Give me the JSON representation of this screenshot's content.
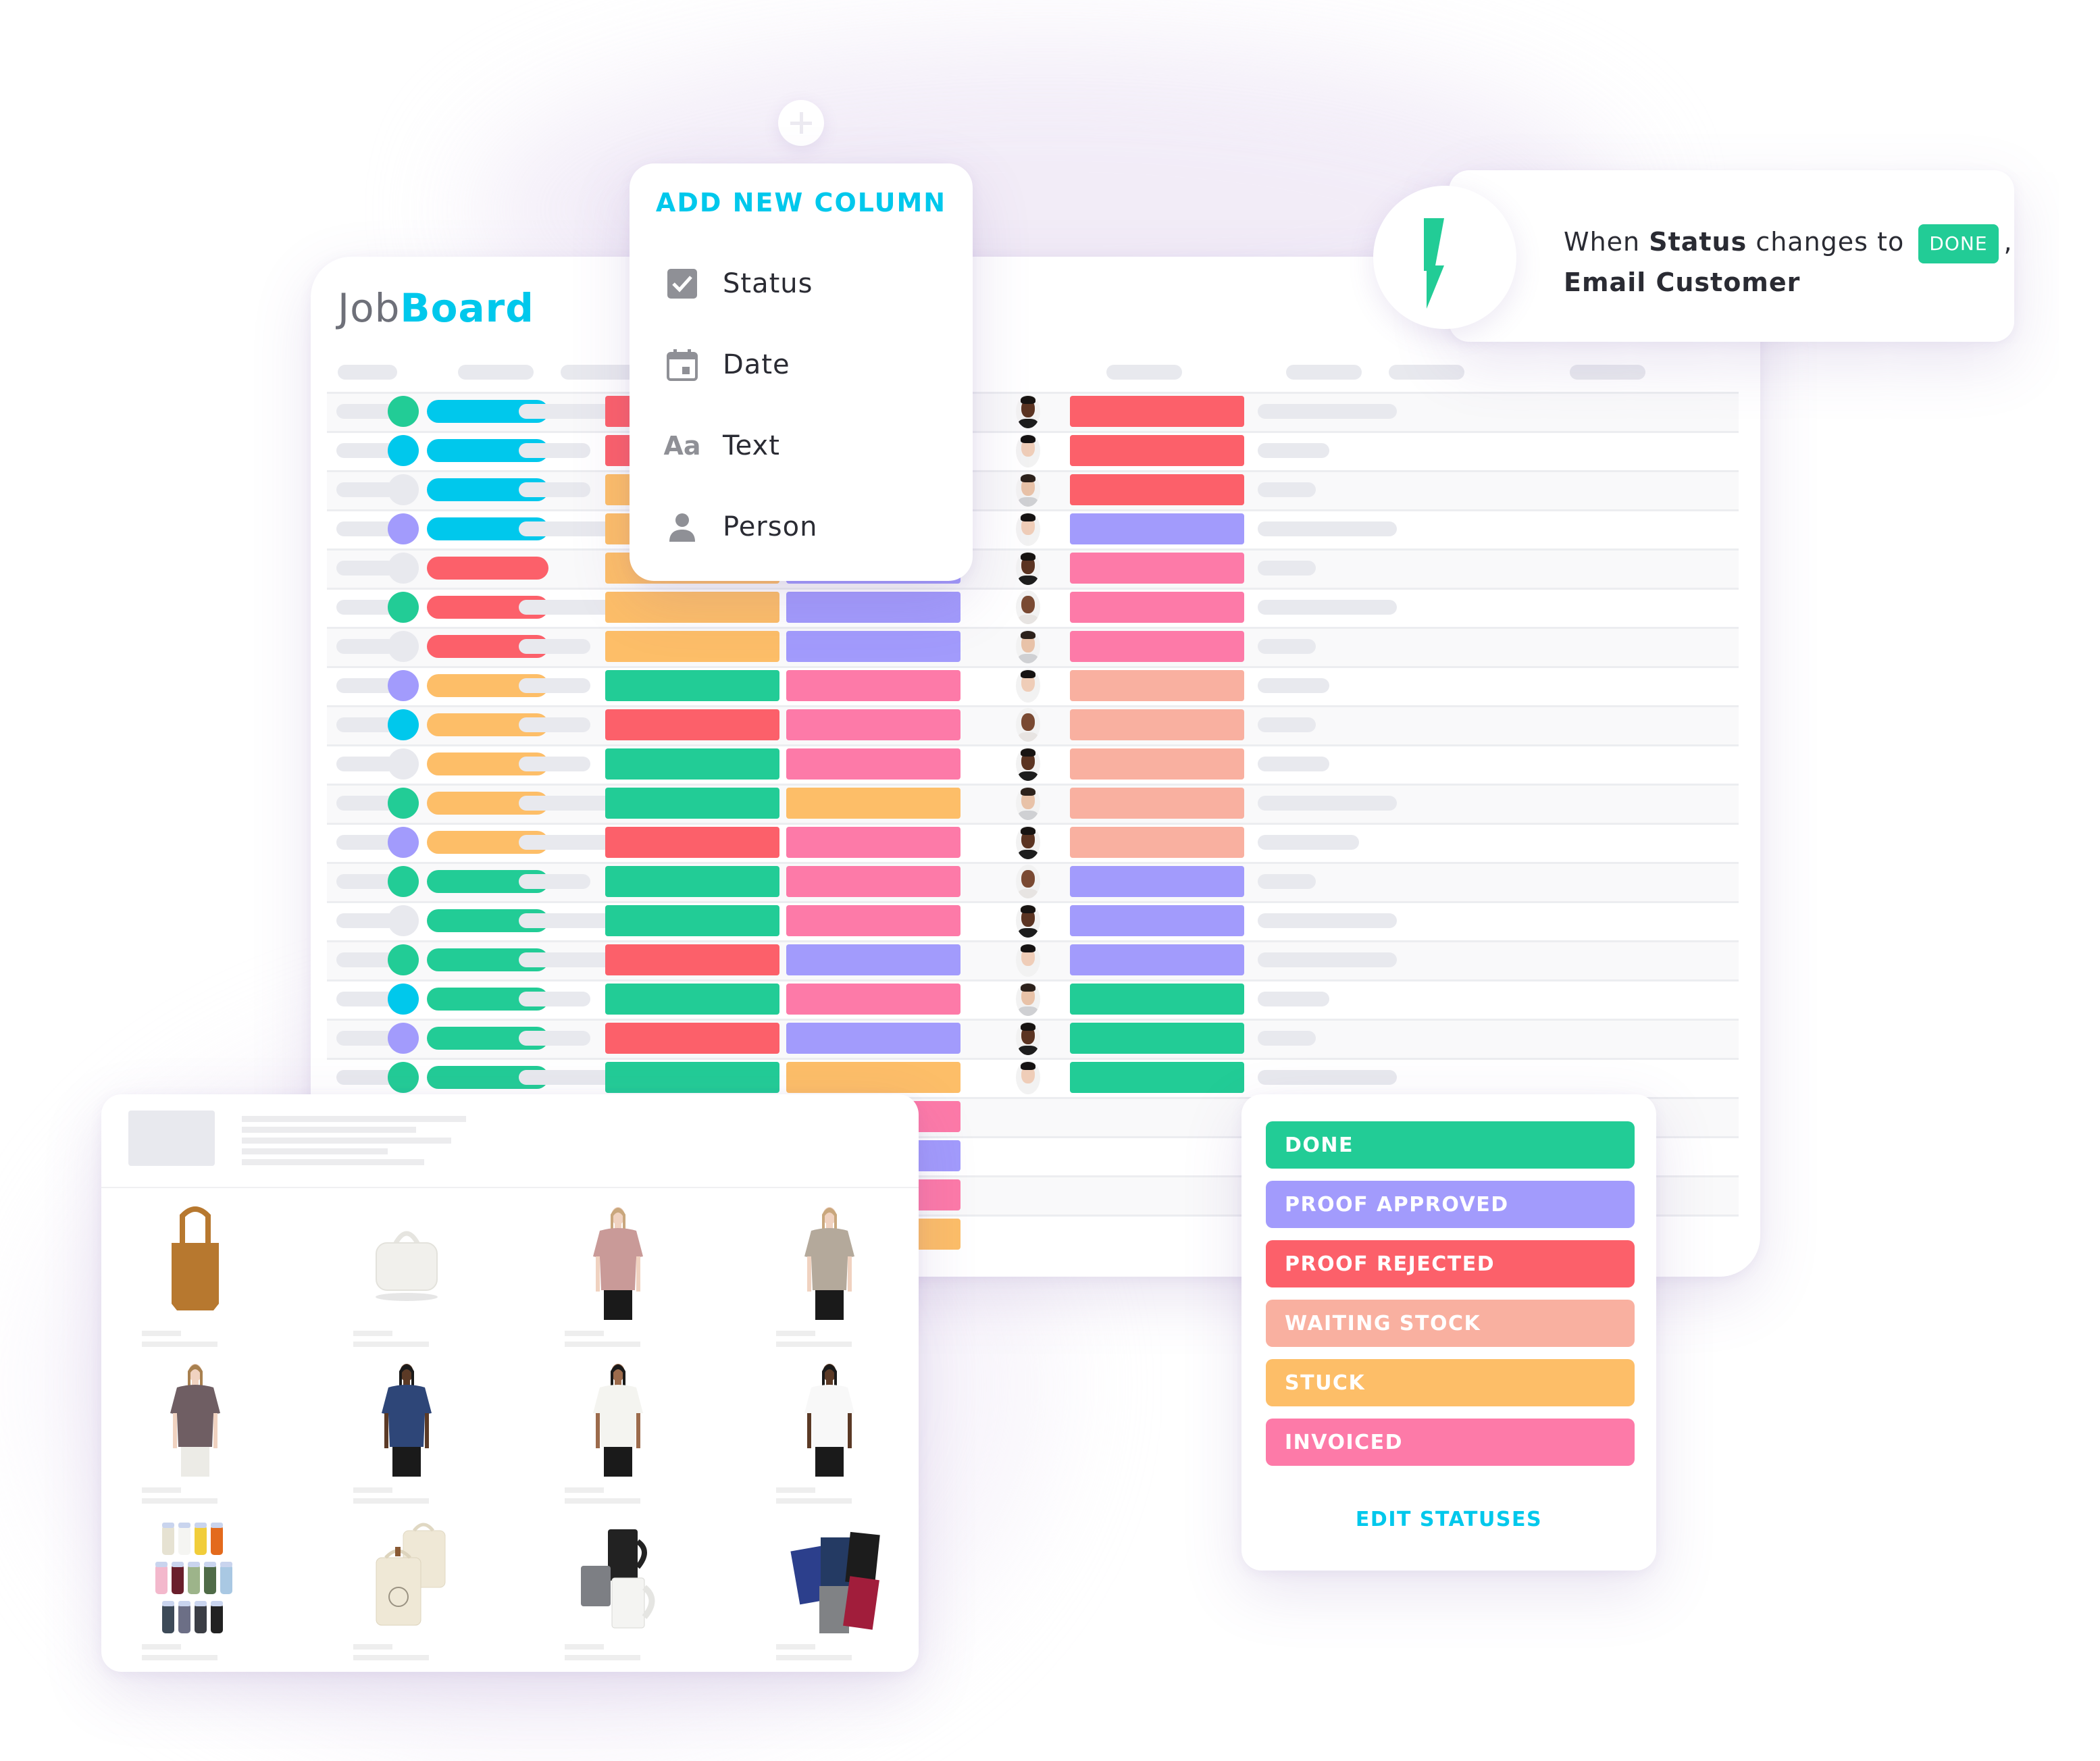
{
  "app": {
    "logo_part1": "Job",
    "logo_part2": "Board"
  },
  "colors": {
    "accent": "#00c8ec",
    "done": "#22cc96",
    "proof_approved": "#a29bfc",
    "proof_rejected": "#fc606a",
    "waiting_stock": "#f9b0a0",
    "stuck": "#fdbe68",
    "invoiced": "#fd7aa8",
    "cyan": "#00c8ec",
    "grey": "#e8e9ee"
  },
  "add_column": {
    "plus_icon": "plus-icon",
    "title": "ADD NEW COLUMN",
    "items": [
      {
        "icon": "checkbox-icon",
        "label": "Status"
      },
      {
        "icon": "calendar-icon",
        "label": "Date"
      },
      {
        "icon": "text-icon",
        "icon_text": "Aa",
        "label": "Text"
      },
      {
        "icon": "person-icon",
        "label": "Person"
      }
    ]
  },
  "automation": {
    "icon": "lightning-icon",
    "prefix": "When",
    "field": "Status",
    "middle": "changes to",
    "badge": "DONE",
    "comma": ",",
    "action": "Email Customer"
  },
  "status_menu": {
    "options": [
      {
        "label": "DONE",
        "color": "#22cc96"
      },
      {
        "label": "PROOF APPROVED",
        "color": "#a29bfc"
      },
      {
        "label": "PROOF REJECTED",
        "color": "#fc606a"
      },
      {
        "label": "WAITING STOCK",
        "color": "#f9b0a0"
      },
      {
        "label": "STUCK",
        "color": "#fdbe68"
      },
      {
        "label": "INVOICED",
        "color": "#fd7aa8"
      }
    ],
    "edit_label": "EDIT STATUSES"
  },
  "table": {
    "rows": [
      {
        "dot": "done",
        "pill": "cyan",
        "a": "proof_rejected",
        "b": "cyan",
        "person": "man-dark",
        "c": "proof_rejected"
      },
      {
        "dot": "cyan",
        "pill": "cyan",
        "a": "proof_rejected",
        "b": "cyan",
        "person": "woman-bun",
        "c": "proof_rejected"
      },
      {
        "dot": "grey",
        "pill": "cyan",
        "a": "stuck",
        "b": "cyan",
        "person": "man-light",
        "c": "proof_rejected"
      },
      {
        "dot": "proof_approved",
        "pill": "cyan",
        "a": "stuck",
        "b": "cyan",
        "person": "woman-bun",
        "c": "proof_approved"
      },
      {
        "dot": "grey",
        "pill": "proof_rejected",
        "a": "stuck",
        "b": "proof_approved",
        "person": "man-dark",
        "c": "invoiced"
      },
      {
        "dot": "done",
        "pill": "proof_rejected",
        "a": "stuck",
        "b": "proof_approved",
        "person": "man-bald",
        "c": "invoiced"
      },
      {
        "dot": "grey",
        "pill": "proof_rejected",
        "a": "stuck",
        "b": "proof_approved",
        "person": "man-light",
        "c": "invoiced"
      },
      {
        "dot": "proof_approved",
        "pill": "stuck",
        "a": "done",
        "b": "invoiced",
        "person": "woman-bun",
        "c": "waiting_stock"
      },
      {
        "dot": "cyan",
        "pill": "stuck",
        "a": "proof_rejected",
        "b": "invoiced",
        "person": "man-bald",
        "c": "waiting_stock"
      },
      {
        "dot": "grey",
        "pill": "stuck",
        "a": "done",
        "b": "invoiced",
        "person": "man-dark",
        "c": "waiting_stock"
      },
      {
        "dot": "done",
        "pill": "stuck",
        "a": "done",
        "b": "stuck",
        "person": "man-light",
        "c": "waiting_stock"
      },
      {
        "dot": "proof_approved",
        "pill": "stuck",
        "a": "proof_rejected",
        "b": "invoiced",
        "person": "man-dark",
        "c": "waiting_stock"
      },
      {
        "dot": "done",
        "pill": "done",
        "a": "done",
        "b": "invoiced",
        "person": "man-bald",
        "c": "proof_approved"
      },
      {
        "dot": "grey",
        "pill": "done",
        "a": "done",
        "b": "invoiced",
        "person": "man-dark",
        "c": "proof_approved"
      },
      {
        "dot": "done",
        "pill": "done",
        "a": "proof_rejected",
        "b": "proof_approved",
        "person": "woman-bun",
        "c": "proof_approved"
      },
      {
        "dot": "cyan",
        "pill": "done",
        "a": "done",
        "b": "invoiced",
        "person": "man-light",
        "c": "done"
      },
      {
        "dot": "proof_approved",
        "pill": "done",
        "a": "proof_rejected",
        "b": "proof_approved",
        "person": "man-dark",
        "c": "done"
      },
      {
        "dot": "done",
        "pill": "done",
        "a": "done",
        "b": "stuck",
        "person": "woman-bun",
        "c": "done"
      },
      {
        "dot": null,
        "pill": null,
        "a": "done",
        "b": "invoiced",
        "person": null,
        "c": null
      },
      {
        "dot": null,
        "pill": null,
        "a": "done",
        "b": "proof_approved",
        "person": null,
        "c": null
      },
      {
        "dot": null,
        "pill": null,
        "a": "done",
        "b": "invoiced",
        "person": null,
        "c": null
      },
      {
        "dot": null,
        "pill": null,
        "a": "done",
        "b": "stuck",
        "person": null,
        "c": null
      }
    ]
  },
  "products": {
    "items": [
      {
        "name": "tote-bag",
        "type": "tote",
        "color": "#b7782f"
      },
      {
        "name": "duffel-bag",
        "type": "duffel",
        "color": "#f1f0ec"
      },
      {
        "name": "pink-tee",
        "type": "tee",
        "color": "#c99a98",
        "skin": "#f0d2c0",
        "hair": "#c9a77d",
        "legs": "#1a1a1a"
      },
      {
        "name": "striped-tee",
        "type": "tee",
        "color": "#b4a99b",
        "skin": "#f0d2c0",
        "hair": "#c9a77d",
        "legs": "#1a1a1a"
      },
      {
        "name": "crop-tee",
        "type": "tee",
        "color": "#6f5e63",
        "skin": "#f0d2c0",
        "hair": "#a8804f",
        "legs": "#ecebe6"
      },
      {
        "name": "navy-tee",
        "type": "tee",
        "color": "#2e4678",
        "skin": "#5b3a26",
        "hair": "#1a1a1a",
        "legs": "#1a1a1a"
      },
      {
        "name": "white-tee",
        "type": "tee",
        "color": "#f4f4f0",
        "skin": "#9c6b4c",
        "hair": "#1a1a1a",
        "legs": "#1a1a1a"
      },
      {
        "name": "white-tee-2",
        "type": "tee",
        "color": "#f8f8f8",
        "skin": "#5b3a26",
        "hair": "#1a1a1a",
        "legs": "#1a1a1a"
      },
      {
        "name": "tumblers",
        "type": "tumblers",
        "colors": [
          "#e6e2d2",
          "#f5f5f2",
          "#f1cd3a",
          "#e36a1d",
          "#f3b8cc",
          "#6a1f2c",
          "#9db48a",
          "#4f6b47",
          "#a9c8e3",
          "#3d4a58",
          "#6c6f86",
          "#3b3e45",
          "#222222"
        ]
      },
      {
        "name": "canvas-backpacks",
        "type": "backpack",
        "color": "#efe8d6"
      },
      {
        "name": "enamel-mugs",
        "type": "mugs",
        "colors": [
          "#222222",
          "#7d7f84",
          "#f4f4f2"
        ]
      },
      {
        "name": "stubby-holders",
        "type": "stubbies",
        "colors": [
          "#2c3f8c",
          "#243a63",
          "#1c1c1c",
          "#808285",
          "#a11d3b"
        ]
      }
    ]
  }
}
